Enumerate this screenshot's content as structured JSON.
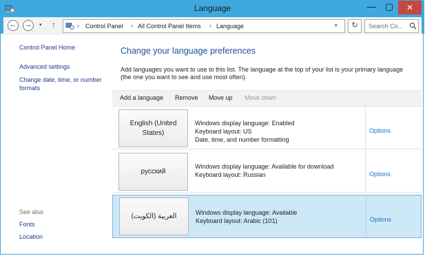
{
  "window": {
    "title": "Language",
    "minimize_glyph": "—",
    "maximize_glyph": "▢",
    "close_glyph": "✕"
  },
  "nav": {
    "back_glyph": "←",
    "forward_glyph": "→",
    "recent_glyph": "▾",
    "up_glyph": "↑"
  },
  "address": {
    "breadcrumbs": [
      "Control Panel",
      "All Control Panel Items",
      "Language"
    ],
    "separator": "›",
    "dropdown_glyph": "▾",
    "refresh_glyph": "↻"
  },
  "search": {
    "placeholder": "Search Co..."
  },
  "sidebar": {
    "home": "Control Panel Home",
    "links": [
      "Advanced settings",
      "Change date, time, or number formats"
    ],
    "see_also_label": "See also",
    "see_also": [
      "Fonts",
      "Location"
    ]
  },
  "main": {
    "heading": "Change your language preferences",
    "description": "Add languages you want to use to this list. The language at the top of your list is your primary language (the one you want to see and use most often).",
    "toolbar": [
      {
        "label": "Add a language",
        "enabled": true
      },
      {
        "label": "Remove",
        "enabled": true
      },
      {
        "label": "Move up",
        "enabled": true
      },
      {
        "label": "Move down",
        "enabled": false
      }
    ],
    "languages": [
      {
        "name": "English (United States)",
        "lines": [
          "Windows display language: Enabled",
          "Keyboard layout: US",
          "Date, time, and number formatting"
        ],
        "options": "Options",
        "selected": false
      },
      {
        "name": "русский",
        "lines": [
          "Windows display language: Available for download",
          "Keyboard layout: Russian"
        ],
        "options": "Options",
        "selected": false
      },
      {
        "name": "العربية (الكويت)",
        "lines": [
          "Windows display language: Available",
          "Keyboard layout: Arabic (101)"
        ],
        "options": "Options",
        "selected": true
      }
    ]
  },
  "colors": {
    "title_bar": "#3fa9df",
    "close_button": "#c7463f",
    "heading": "#1e4fa0",
    "link": "#1f6fc2",
    "selected_row": "#cde8f7"
  },
  "icons": {
    "app": "control-panel-icon",
    "search": "search-icon",
    "refresh": "refresh-icon"
  }
}
